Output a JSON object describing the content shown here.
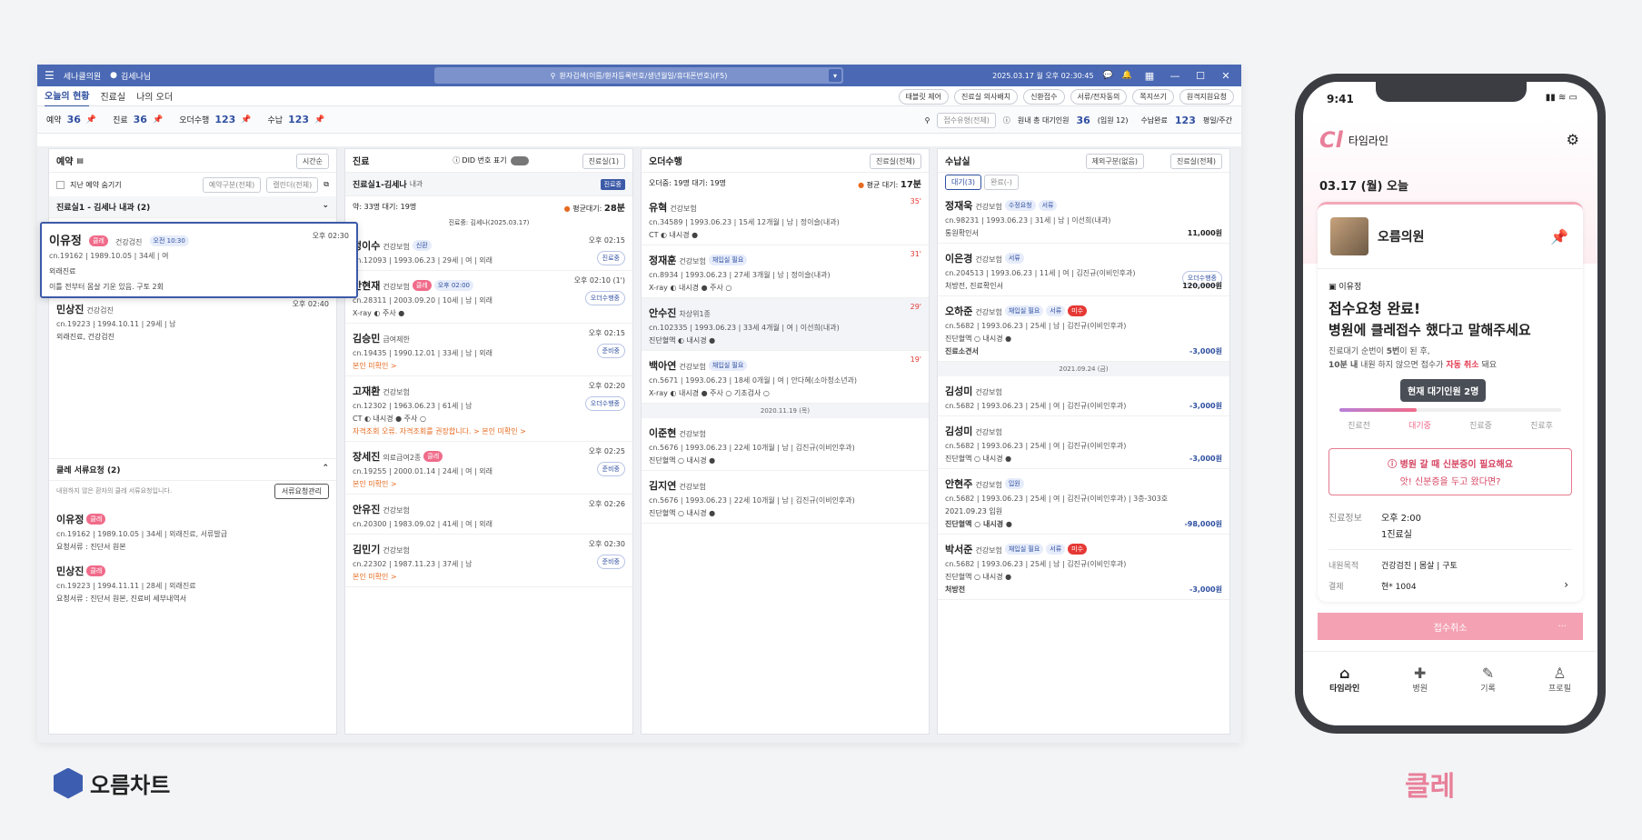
{
  "titlebar": {
    "clinic": "세나클의원",
    "user": "김세나님",
    "search_placeholder": "환자검색(이름/환자등록번호/생년월일/휴대폰번호)(F5)",
    "datetime": "2025.03.17 월 오후 02:30:45"
  },
  "tabs": [
    "오늘의 현황",
    "진료실",
    "나의 오더"
  ],
  "toolbar": [
    "태블릿 제어",
    "진료실 의사배치",
    "신환접수",
    "서류/전자동의",
    "쪽지쓰기",
    "원격지원요청"
  ],
  "stats": [
    {
      "label": "예약",
      "value": "36"
    },
    {
      "label": "진료",
      "value": "36"
    },
    {
      "label": "오더수행",
      "value": "123"
    },
    {
      "label": "수납",
      "value": "123"
    }
  ],
  "statright": {
    "select": "접수유형(전체)",
    "wait_label": "원내 총 대기인원",
    "wait_value": "36",
    "wait_extra": "(입원 12)",
    "done_label": "수납완료",
    "done_value": "123",
    "period": "평일/주간"
  },
  "reservation": {
    "title": "예약",
    "sort": "시간순",
    "hide_past": "지난 예약 숨기기",
    "filter1": "예약구분(전체)",
    "filter2": "캘린더(전체)",
    "group": "진료실1 - 김세나 내과 (2)",
    "popup": {
      "name": "이유정",
      "badge": "클레",
      "ins": "건강검진",
      "time_badge": "오전 10:30",
      "time": "오후 02:30",
      "meta": "cn.19162 | 1989.10.05 | 34세 | 여",
      "line1": "외래진료",
      "line2": "이틀 전부터 몸살 기운 있음. 구토 2회"
    },
    "items": [
      {
        "name": "민상진",
        "ins": "건강검진",
        "time": "오후 02:40",
        "meta": "cn.19223 | 1994.10.11 | 29세 | 남",
        "sub": "외래진료, 건강검진"
      }
    ],
    "req_title": "클레 서류요청 (2)",
    "req_note": "내원하지 않은 환자의 클레 서류요청입니다.",
    "req_btn": "서류요청관리",
    "reqs": [
      {
        "name": "이유정",
        "badge": "클레",
        "meta": "cn.19162 | 1989.10.05 | 34세 | 외래진료, 서류발급",
        "sub": "요청서류 : 진단서 원본"
      },
      {
        "name": "민상진",
        "badge": "클레",
        "meta": "cn.19223 | 1994.11.11 | 28세 | 외래진료",
        "sub": "요청서류 : 진단서 원본, 진료비 세부내역서"
      }
    ]
  },
  "clinic": {
    "title": "진료",
    "did": "DID 번호 표기",
    "room": "진료실(1)",
    "subtitle": "진료실1-김세나",
    "subtitle2": "내과",
    "status": "진료중",
    "waiting": "약: 33명  대기: 19명",
    "avg_label": "평균대기:",
    "avg": "28분",
    "doctor": "진료중: 김세나(2025.03.17)",
    "items": [
      {
        "name": "정이수",
        "ins": "건강보험",
        "badge": "신환",
        "time": "오후 02:15",
        "meta": "cn.12093 | 1993.06.23 | 29세 | 여 | 외래",
        "pill": "진료중"
      },
      {
        "name": "안현재",
        "ins": "건강보험",
        "badge": "클레",
        "badge2": "오후 02:00",
        "time": "오후 02:10 (1')",
        "meta": "cn.28311 | 2003.09.20 | 10세 | 남 | 외래",
        "sub": "X-ray ◐  주사 ●",
        "pill": "오더수행중"
      },
      {
        "name": "김승민",
        "ins": "급여제한",
        "time": "오후 02:15",
        "meta": "cn.19435 | 1990.12.01 | 33세 | 남 | 외래",
        "warn": "본인 미확인 >",
        "pill": "준비중"
      },
      {
        "name": "고재환",
        "ins": "건강보험",
        "time": "오후 02:20",
        "meta": "cn.12302 | 1963.06.23 | 61세 | 남",
        "sub": "CT ◐  내시경 ●  주사 ○",
        "warn": "자격조회 오류. 자격조회를 권장합니다. >  본인 미확인 >",
        "pill": "오더수행중"
      },
      {
        "name": "장세진",
        "ins": "의료급여2종",
        "badge": "클레",
        "time": "오후 02:25",
        "meta": "cn.19255 | 2000.01.14 | 24세 | 여 | 외래",
        "warn": "본인 미확인 >",
        "pill": "준비중"
      },
      {
        "name": "안유진",
        "ins": "건강보험",
        "time": "오후 02:26",
        "meta": "cn.20300 | 1983.09.02 | 41세 | 여 | 외래"
      },
      {
        "name": "김민기",
        "ins": "건강보험",
        "time": "오후 02:30",
        "meta": "cn.22302 | 1987.11.23 | 37세 | 남",
        "warn": "본인 미확인 >",
        "pill": "준비중"
      }
    ]
  },
  "orders": {
    "title": "오더수행",
    "room": "진료실(전체)",
    "waiting": "오더중: 19명  대기: 19명",
    "avg_label": "평균 대기:",
    "avg": "17분",
    "items": [
      {
        "name": "유혁",
        "ins": "건강보험",
        "time": "35'",
        "meta": "cn.34589 | 1993.06.23 | 15세 12개월 | 남 | 정이슬(내과)",
        "sub": "CT ◐  내시경 ●"
      },
      {
        "name": "정재훈",
        "ins": "건강보험",
        "badge": "채입실 필요",
        "time": "31'",
        "meta": "cn.8934 | 1993.06.23 | 27세 3개월 | 남 | 정이슬(내과)",
        "sub": "X-ray ◐  내시경 ●  주사 ○"
      },
      {
        "name": "안수진",
        "ins": "차상위1종",
        "time": "29'",
        "meta": "cn.102335 | 1993.06.23 | 33세 4개월 | 여 | 이선희(내과)",
        "sub": "진단혈액 ◐  내시경 ●",
        "hl": true
      },
      {
        "name": "백아연",
        "ins": "건강보험",
        "badge": "채입실 필요",
        "time": "19'",
        "meta": "cn.5671 | 1993.06.23 | 18세 0개월 | 여 | 안다혜(소아청소년과)",
        "sub": "X-ray ◐  내시경 ●  주사 ○  기초검사 ○"
      }
    ],
    "divider": "2020.11.19 (목)",
    "items2": [
      {
        "name": "이준현",
        "ins": "건강보험",
        "meta": "cn.5676 | 1993.06.23 | 22세 10개월 | 남 | 김진규(이비인후과)",
        "sub": "진단혈액 ○  내시경 ●"
      },
      {
        "name": "김지연",
        "ins": "건강보험",
        "meta": "cn.5676 | 1993.06.23 | 22세 10개월 | 남 | 김진규(이비인후과)",
        "sub": "진단혈액 ○  내시경 ●"
      }
    ]
  },
  "payment": {
    "title": "수납실",
    "filter1": "제외구분(없음)",
    "filter2": "진료실(전체)",
    "tab1": "대기(3)",
    "tab2": "완료(-)",
    "items": [
      {
        "name": "정재욱",
        "ins": "건강보험",
        "badge": "수정요청",
        "badge2": "서류",
        "meta": "cn.98231 | 1993.06.23 | 31세 | 남 | 이선희(내과)",
        "sub": "통원확인서",
        "amt": "11,000원"
      },
      {
        "name": "이은경",
        "ins": "건강보험",
        "badge": "서류",
        "meta": "cn.204513 | 1993.06.23 | 11세 | 여 | 김진규(이비인후과)",
        "sub": "처방전, 진료확인서",
        "amt": "120,000원",
        "pill": "오더수행중"
      },
      {
        "name": "오하준",
        "ins": "건강보험",
        "badge": "채입실 필요",
        "badge2": "서류",
        "badge3": "미수",
        "meta": "cn.5682 | 1993.06.23 | 25세 | 남 | 김진규(이비인후과)",
        "sub": "진단혈액 ○  내시경 ●",
        "sub2": "진료소견서",
        "amt": "-3,000원"
      }
    ],
    "divider": "2021.09.24 (금)",
    "items2": [
      {
        "name": "김성미",
        "ins": "건강보험",
        "meta": "cn.5682 | 1993.06.23 | 25세 | 여 | 김진규(이비인후과)",
        "amt": "-3,000원"
      },
      {
        "name": "김성미",
        "ins": "건강보험",
        "meta": "cn.5682 | 1993.06.23 | 25세 | 여 | 김진규(이비인후과)",
        "sub": "진단혈액 ○  내시경 ●",
        "amt": "-3,000원"
      },
      {
        "name": "안현주",
        "ins": "건강보험",
        "badge": "입원",
        "meta": "cn.5682 | 1993.06.23 | 25세 | 여 | 김진규(이비인후과) | 3층-303호",
        "sub": "2021.09.23 입원",
        "sub2": "진단혈액 ○  내시경 ●",
        "amt": "-98,000원"
      },
      {
        "name": "박서준",
        "ins": "건강보험",
        "badge": "채입실 필요",
        "badge2": "서류",
        "badge3": "미수",
        "meta": "cn.5682 | 1993.06.23 | 25세 | 남 | 김진규(이비인후과)",
        "sub": "진단혈액 ○  내시경 ●",
        "sub2": "처방전",
        "amt": "-3,000원"
      }
    ]
  },
  "phone": {
    "time": "9:41",
    "app": "타임라인",
    "date": "03.17 (월) 오늘",
    "hospital": "오름의원",
    "patient": "이유정",
    "headline1": "접수요청 완료!",
    "headline2": "병원에 클레접수 했다고 말해주세요",
    "desc1a": "진료대기 순번이 ",
    "desc1b": "5번",
    "desc1c": "이 된 후,",
    "desc2a": "10분 내",
    "desc2b": " 내원 하지 않으면 접수가 ",
    "desc2c": "자동 취소",
    "desc2d": " 돼요",
    "tooltip": "현재 대기인원 2명",
    "progress": 0.35,
    "steps": [
      "진료전",
      "대기중",
      "진료중",
      "진료후"
    ],
    "alert1": "병원 갈 때 신분증이 필요해요",
    "alert2": "앗! 신분증을 두고 왔다면?",
    "info_label": "진료정보",
    "info1": "오후 2:00",
    "info2": "1진료실",
    "purpose_label": "내원목적",
    "purpose": "건강검진 | 몸살 | 구토",
    "pay_label": "결제",
    "pay": "현* 1004",
    "cancel": "접수취소",
    "more": "···",
    "nav": [
      "타임라인",
      "병원",
      "기록",
      "프로필"
    ]
  },
  "brand": {
    "left": "오름차트",
    "right": "클레"
  },
  "colors": {
    "primary": "#4a68b3",
    "pink": "#f06b8a",
    "accent": "#e53935"
  }
}
